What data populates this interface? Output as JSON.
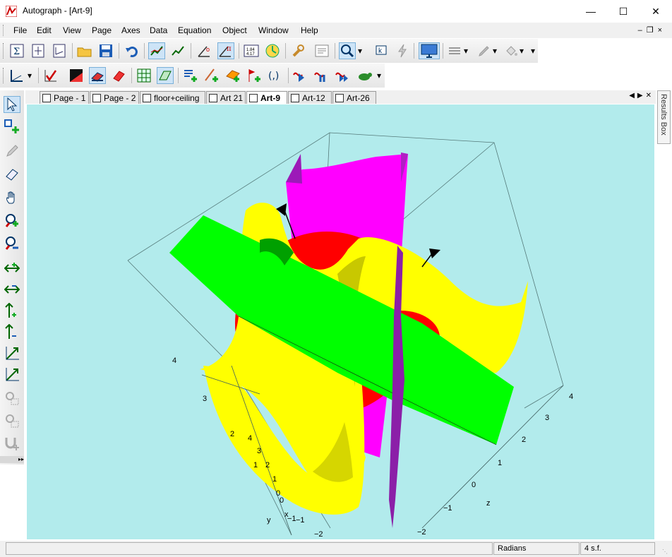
{
  "window": {
    "title": "Autograph - [Art-9]"
  },
  "menu": {
    "items": [
      "File",
      "Edit",
      "View",
      "Page",
      "Axes",
      "Data",
      "Equation",
      "Object",
      "Window",
      "Help"
    ]
  },
  "tabs": [
    "Page - 1",
    "Page - 2",
    "floor+ceiling",
    "Art 21",
    "Art-9",
    "Art-12",
    "Art-26"
  ],
  "active_tab": "Art-9",
  "results_box": "Results Box",
  "status": {
    "angle_mode": "Radians",
    "precision": "4 s.f."
  },
  "axes3d": {
    "x_label": "x",
    "y_label": "y",
    "z_label": "z",
    "x_ticks": [
      "4",
      "3",
      "2",
      "1",
      "0",
      "−1",
      "−2"
    ],
    "y_ticks": [
      "4",
      "3",
      "2",
      "1",
      "0",
      "−1"
    ],
    "z_ticks": [
      "4",
      "3",
      "2",
      "1",
      "0",
      "−1",
      "−2"
    ]
  },
  "colors": {
    "canvas": "#b2ebec",
    "red": "#ff0000",
    "green": "#00ff00",
    "yellow": "#ffff00",
    "magenta": "#ff00ff",
    "purple": "#8b1fa8"
  }
}
